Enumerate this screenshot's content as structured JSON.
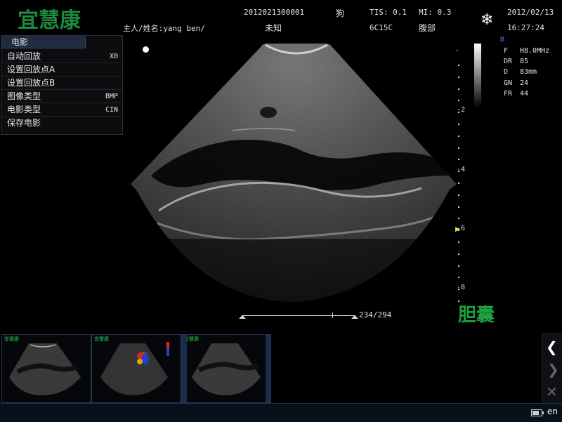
{
  "header": {
    "logo": "宜慧康",
    "owner_label": "主人/姓名:yang ben/",
    "patient_id": "2012021300001",
    "species": "狗",
    "unknown": "未知",
    "tis": "TIS: 0.1",
    "mi": "MI: 0.3",
    "probe": "6C15C",
    "region": "腹部",
    "date": "2012/02/13",
    "time": "16:27:24",
    "freeze_icon": "snowflake-icon"
  },
  "cine_menu": {
    "title": "电影",
    "items": [
      {
        "label": "自动回放",
        "value": "X0"
      },
      {
        "label": "设置回放点A",
        "value": ""
      },
      {
        "label": "设置回放点B",
        "value": ""
      },
      {
        "label": "图像类型",
        "value": "BMP"
      },
      {
        "label": "电影类型",
        "value": "CIN"
      },
      {
        "label": "保存电影",
        "value": ""
      }
    ]
  },
  "image_params": {
    "mode": "B",
    "rows": [
      {
        "key": "F",
        "value": "H8.0MHz"
      },
      {
        "key": "DR",
        "value": "85"
      },
      {
        "key": "D",
        "value": "83mm"
      },
      {
        "key": "GN",
        "value": "24"
      },
      {
        "key": "FR",
        "value": "44"
      }
    ]
  },
  "depth_scale": {
    "labels": [
      "-",
      "-2",
      "-4",
      "-6",
      "-8"
    ],
    "focus_marker": "focus-arrow-icon"
  },
  "cine_bar": {
    "frame": "234/294",
    "position": 0.796
  },
  "organ_label": "胆囊",
  "thumbnails": [
    {
      "logo": "宜慧康",
      "type": "grayscale"
    },
    {
      "logo": "宜慧康",
      "type": "color-doppler"
    },
    {
      "logo": "宜慧康",
      "type": "grayscale"
    }
  ],
  "nav": {
    "prev_icon": "chevron-left-icon",
    "next_icon": "chevron-right-icon",
    "close_icon": "close-icon"
  },
  "status": {
    "battery_icon": "battery-icon",
    "language": "en"
  },
  "colors": {
    "brand_green": "#1c8a3c",
    "menu_title_bg": "#1f2b3f",
    "status_bg": "#07111c"
  }
}
